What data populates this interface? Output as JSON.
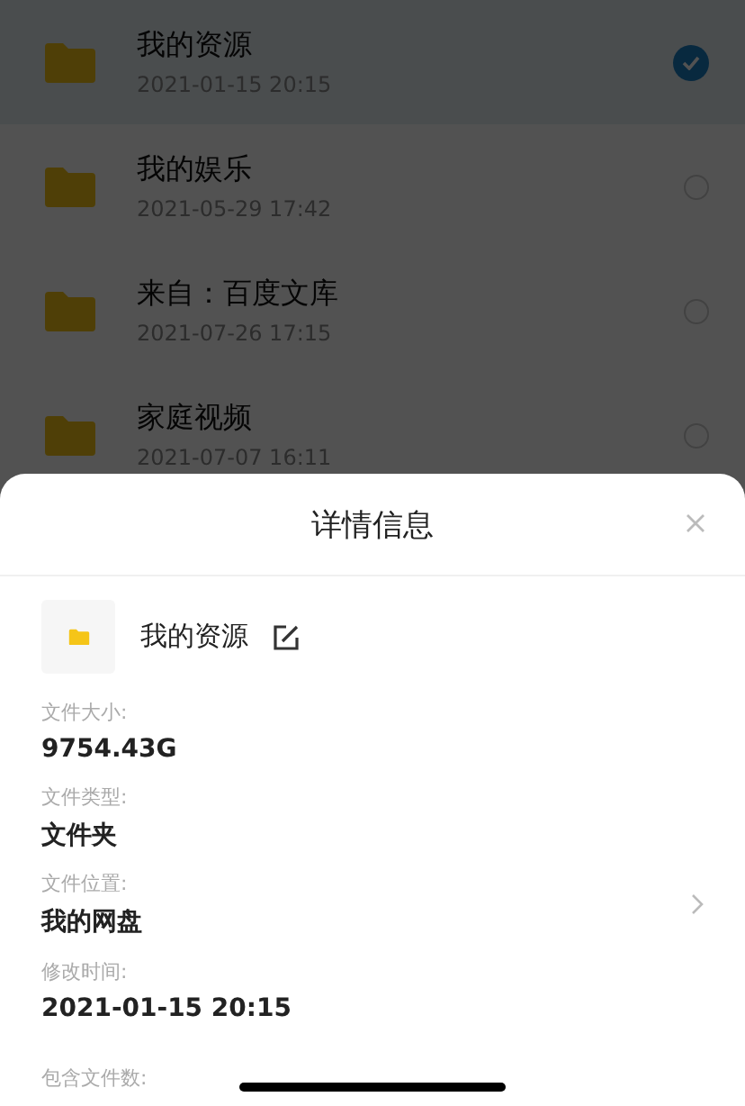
{
  "files": [
    {
      "name": "我的资源",
      "time": "2021-01-15 20:15",
      "selected": true
    },
    {
      "name": "我的娱乐",
      "time": "2021-05-29 17:42",
      "selected": false
    },
    {
      "name": "来自：百度文库",
      "time": "2021-07-26 17:15",
      "selected": false
    },
    {
      "name": "家庭视频",
      "time": "2021-07-07 16:11",
      "selected": false
    }
  ],
  "sheet": {
    "title": "详情信息",
    "file_name": "我的资源",
    "fields": [
      {
        "label": "文件大小:",
        "value": "9754.43G",
        "kind": "text"
      },
      {
        "label": "文件类型:",
        "value": "文件夹",
        "kind": "text"
      },
      {
        "label": "文件位置:",
        "value": "我的网盘",
        "kind": "link"
      },
      {
        "label": "修改时间:",
        "value": "2021-01-15 20:15",
        "kind": "text"
      },
      {
        "label": "包含文件数:",
        "kind": "text"
      }
    ]
  }
}
